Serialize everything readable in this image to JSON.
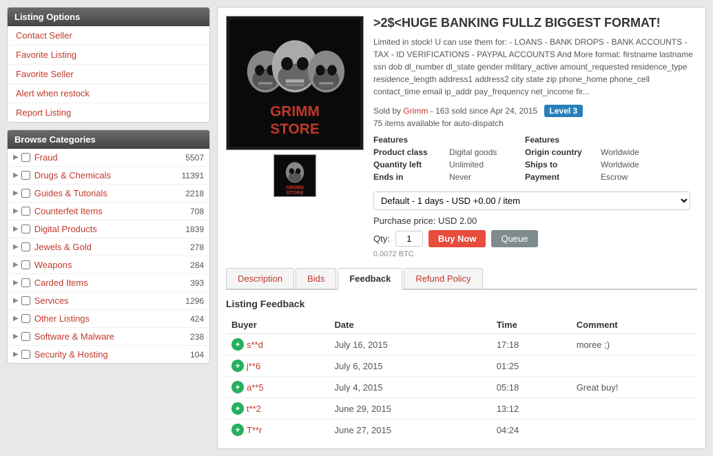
{
  "sidebar": {
    "listing_options_title": "Listing Options",
    "links": [
      {
        "label": "Contact Seller",
        "id": "contact-seller"
      },
      {
        "label": "Favorite Listing",
        "id": "favorite-listing"
      },
      {
        "label": "Favorite Seller",
        "id": "favorite-seller"
      },
      {
        "label": "Alert when restock",
        "id": "alert-restock"
      },
      {
        "label": "Report Listing",
        "id": "report-listing"
      }
    ],
    "browse_title": "Browse Categories",
    "categories": [
      {
        "name": "Fraud",
        "count": "5507"
      },
      {
        "name": "Drugs & Chemicals",
        "count": "11391"
      },
      {
        "name": "Guides & Tutorials",
        "count": "2218"
      },
      {
        "name": "Counterfeit Items",
        "count": "708"
      },
      {
        "name": "Digital Products",
        "count": "1839"
      },
      {
        "name": "Jewels & Gold",
        "count": "278"
      },
      {
        "name": "Weapons",
        "count": "284"
      },
      {
        "name": "Carded Items",
        "count": "393"
      },
      {
        "name": "Services",
        "count": "1296"
      },
      {
        "name": "Other Listings",
        "count": "424"
      },
      {
        "name": "Software & Malware",
        "count": "238"
      },
      {
        "name": "Security & Hosting",
        "count": "104"
      }
    ]
  },
  "product": {
    "title": ">2$<HUGE BANKING FULLZ BIGGEST FORMAT!",
    "description": "Limited in stock! U can use them for: - LOANS - BANK DROPS - BANK ACCOUNTS - TAX - ID VERIFICATIONS - PAYPAL ACCOUNTS And More format: firstname lastname ssn dob dl_number dl_state gender military_active amount_requested residence_type residence_length address1 address2 city state zip phone_home phone_cell contact_time email ip_addr pay_frequency net_income fir...",
    "sold_by_label": "Sold by",
    "seller_name": "Grimm",
    "sold_count": "163",
    "sold_since": "Apr 24, 2015",
    "level_badge": "Level 3",
    "auto_dispatch": "75 items available for auto-dispatch",
    "features_header": "Features",
    "features_header2": "Features",
    "product_class_label": "Product class",
    "product_class_value": "Digital goods",
    "quantity_left_label": "Quantity left",
    "quantity_left_value": "Unlimited",
    "ends_in_label": "Ends in",
    "ends_in_value": "Never",
    "origin_country_label": "Origin country",
    "origin_country_value": "Worldwide",
    "ships_to_label": "Ships to",
    "ships_to_value": "Worldwide",
    "payment_label": "Payment",
    "payment_value": "Escrow",
    "shipping_option": "Default - 1 days - USD +0.00 / item",
    "purchase_price_label": "Purchase price:",
    "purchase_price_value": "USD 2.00",
    "qty_label": "Qty:",
    "qty_value": "1",
    "btn_buy": "Buy Now",
    "btn_queue": "Queue",
    "btc_price": "0.0072 BTC"
  },
  "tabs": [
    {
      "label": "Description",
      "id": "description",
      "active": false
    },
    {
      "label": "Bids",
      "id": "bids",
      "active": false
    },
    {
      "label": "Feedback",
      "id": "feedback",
      "active": true
    },
    {
      "label": "Refund Policy",
      "id": "refund-policy",
      "active": false
    }
  ],
  "feedback": {
    "section_title": "Listing Feedback",
    "columns": [
      "Buyer",
      "Date",
      "Time",
      "Comment"
    ],
    "rows": [
      {
        "buyer": "s**d",
        "date": "July 16, 2015",
        "time": "17:18",
        "comment": "moree ;)"
      },
      {
        "buyer": "j**6",
        "date": "July 6, 2015",
        "time": "01:25",
        "comment": ""
      },
      {
        "buyer": "a**5",
        "date": "July 4, 2015",
        "time": "05:18",
        "comment": "Great buy!"
      },
      {
        "buyer": "t**2",
        "date": "June 29, 2015",
        "time": "13:12",
        "comment": ""
      },
      {
        "buyer": "T**r",
        "date": "June 27, 2015",
        "time": "04:24",
        "comment": ""
      }
    ]
  }
}
